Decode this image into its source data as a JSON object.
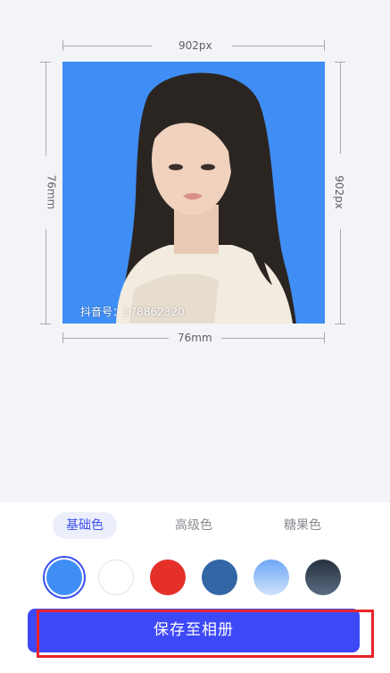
{
  "dimensions": {
    "top_label": "902px",
    "bottom_label": "76mm",
    "left_label": "76mm",
    "right_label": "902px"
  },
  "photo": {
    "background_color": "#3f8ef5",
    "watermark_text": "抖音号：178862320",
    "subject": "portrait-photo"
  },
  "tabs": [
    {
      "label": "基础色",
      "active": true
    },
    {
      "label": "高级色",
      "active": false
    },
    {
      "label": "糖果色",
      "active": false
    }
  ],
  "swatches": [
    {
      "name": "blue",
      "color": "#3f8ef5",
      "selected": true
    },
    {
      "name": "white",
      "color": "#ffffff",
      "selected": false
    },
    {
      "name": "red",
      "color": "#e5302a",
      "selected": false
    },
    {
      "name": "dark-blue",
      "color": "#3266a5",
      "selected": false
    },
    {
      "name": "light-blue-gradient",
      "color": "#89b7f7",
      "selected": false
    },
    {
      "name": "slate-gradient",
      "color": "#3b4a5e",
      "selected": false
    }
  ],
  "actions": {
    "save_label": "保存至相册"
  },
  "colors": {
    "accent": "#3d49f7",
    "highlight": "#e8232a"
  }
}
